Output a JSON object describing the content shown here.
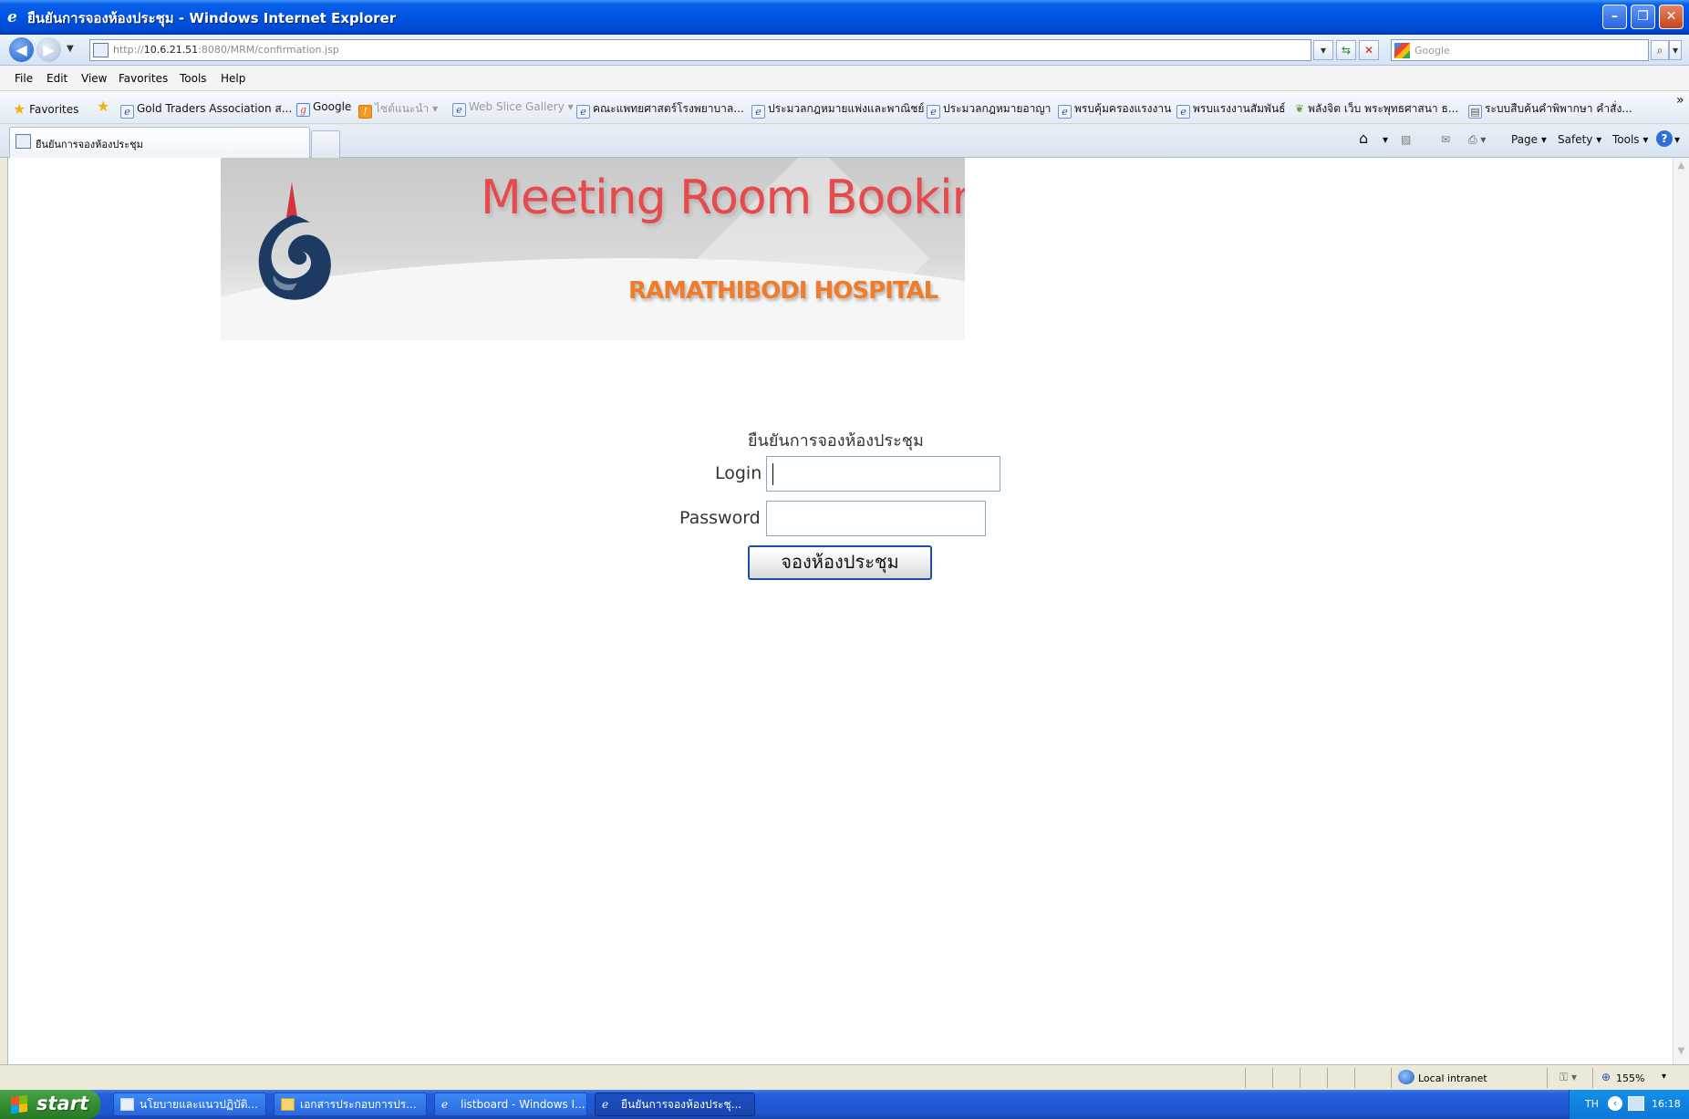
{
  "window": {
    "title": "ยืนยันการจองห้องประชุม - Windows Internet Explorer"
  },
  "address": {
    "url_prefix": "http://",
    "url_host": "10.6.21.51",
    "url_rest": ":8080/MRM/confirmation.jsp",
    "search_placeholder": "Google"
  },
  "menu": [
    "File",
    "Edit",
    "View",
    "Favorites",
    "Tools",
    "Help"
  ],
  "favorites": {
    "label": "Favorites",
    "items": [
      {
        "label": "Gold Traders Association  ส...",
        "icon": "ie-page-icon"
      },
      {
        "label": "Google",
        "icon": "google-icon"
      },
      {
        "label": "ไซต์แนะนำ ▾",
        "icon": "suggested-sites-icon"
      },
      {
        "label": "Web Slice Gallery ▾",
        "icon": "ie-page-icon"
      },
      {
        "label": "คณะแพทยศาสตร์โรงพยาบาล...",
        "icon": "ie-page-icon"
      },
      {
        "label": "ประมวลกฎหมายแพ่งและพาณิชย์",
        "icon": "ie-page-icon"
      },
      {
        "label": "ประมวลกฎหมายอาญา",
        "icon": "ie-page-icon"
      },
      {
        "label": "พรบคุ้มครองแรงงาน",
        "icon": "ie-page-icon"
      },
      {
        "label": "พรบแรงงานสัมพันธ์",
        "icon": "ie-page-icon"
      },
      {
        "label": "พลังจิต เว็บ พระพุทธศาสนา ธ...",
        "icon": "leaf-icon"
      },
      {
        "label": "ระบบสืบค้นคำพิพากษา คำสั่ง...",
        "icon": "page-icon"
      }
    ]
  },
  "tab": {
    "title": "ยืนยันการจองห้องประชุม"
  },
  "command_bar": {
    "page": "Page ▾",
    "safety": "Safety ▾",
    "tools": "Tools ▾"
  },
  "banner": {
    "title": "Meeting Room Booking",
    "subtitle": "RAMATHIBODI HOSPITAL"
  },
  "form": {
    "heading": "ยืนยันการจองห้องประชุม",
    "login_label": "Login",
    "login_value": "",
    "password_label": "Password",
    "password_value": "",
    "submit_label": "จองห้องประชุม"
  },
  "status": {
    "zone": "Local intranet",
    "zoom": "155%"
  },
  "taskbar": {
    "start": "start",
    "tasks": [
      {
        "label": "นโยบายและแนวปฏิบัติ...",
        "active": false
      },
      {
        "label": "เอกสารประกอบการปร...",
        "active": false
      },
      {
        "label": "listboard - Windows I...",
        "active": false
      },
      {
        "label": "ยืนยันการจองห้องประชุ...",
        "active": true
      }
    ],
    "lang": "TH",
    "clock": "16:18"
  }
}
